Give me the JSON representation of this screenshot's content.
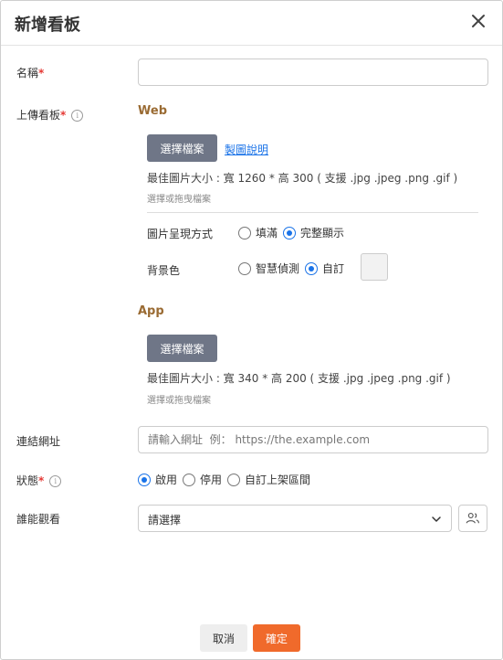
{
  "dialog": {
    "title": "新增看板"
  },
  "form": {
    "name_label": "名稱",
    "upload_label": "上傳看板",
    "link_label": "連結網址",
    "status_label": "狀態",
    "viewer_label": "誰能觀看",
    "required_mark": "*",
    "name_value": "",
    "link_placeholder": "請輸入網址  例： https://the.example.com"
  },
  "web": {
    "title": "Web",
    "choose_file": "選擇檔案",
    "guide_link": "製圖說明",
    "size_hint": "最佳圖片大小 : 寬 1260 * 高 300 ( 支援 .jpg .jpeg .png .gif )",
    "drag_hint": "選擇或拖曳檔案",
    "display_mode_label": "圖片呈現方式",
    "display_mode_options": [
      "填滿",
      "完整顯示"
    ],
    "display_mode_selected": "完整顯示",
    "bg_label": "背景色",
    "bg_options": [
      "智慧偵測",
      "自訂"
    ],
    "bg_selected": "自訂",
    "bg_color": "#f2f2f2"
  },
  "app": {
    "title": "App",
    "choose_file": "選擇檔案",
    "size_hint": "最佳圖片大小 : 寬 340 * 高 200 ( 支援 .jpg .jpeg .png .gif )",
    "drag_hint": "選擇或拖曳檔案"
  },
  "status": {
    "options": [
      "啟用",
      "停用",
      "自訂上架區間"
    ],
    "selected": "啟用"
  },
  "viewer": {
    "value": "請選擇"
  },
  "footer": {
    "cancel": "取消",
    "confirm": "確定"
  },
  "colors": {
    "accent": "#1a73e8",
    "confirm": "#f06a2b",
    "required": "#e53935",
    "section_title": "#9a6b33",
    "gray_button": "#6f7687"
  }
}
